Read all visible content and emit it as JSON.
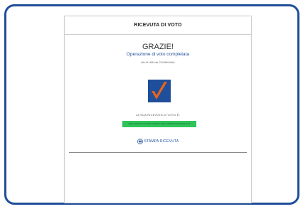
{
  "header": {
    "title": "RICEVUTA DI VOTO"
  },
  "confirmation": {
    "thanks": "GRAZIE!",
    "subtitle": "Operazione di voto completata",
    "time": "alle HH:MM del GG/MM/AAAA"
  },
  "receipt": {
    "label": "LA SUA RICEVUTA DI VOTO È:",
    "code": "8e5a9c0d4e1f7a3b2c6d9e0f1a2b3c4d5e6f7a8b9c0d1e2f"
  },
  "actions": {
    "print_label": "STAMPA RICEVUTA"
  },
  "icons": {
    "logo": "voting-check-logo-icon",
    "print": "printer-icon"
  },
  "colors": {
    "frame": "#1f4e9a",
    "accent": "#1f4e9a",
    "receipt_bg": "#2ec45a",
    "logo_check": "#e8641c"
  }
}
